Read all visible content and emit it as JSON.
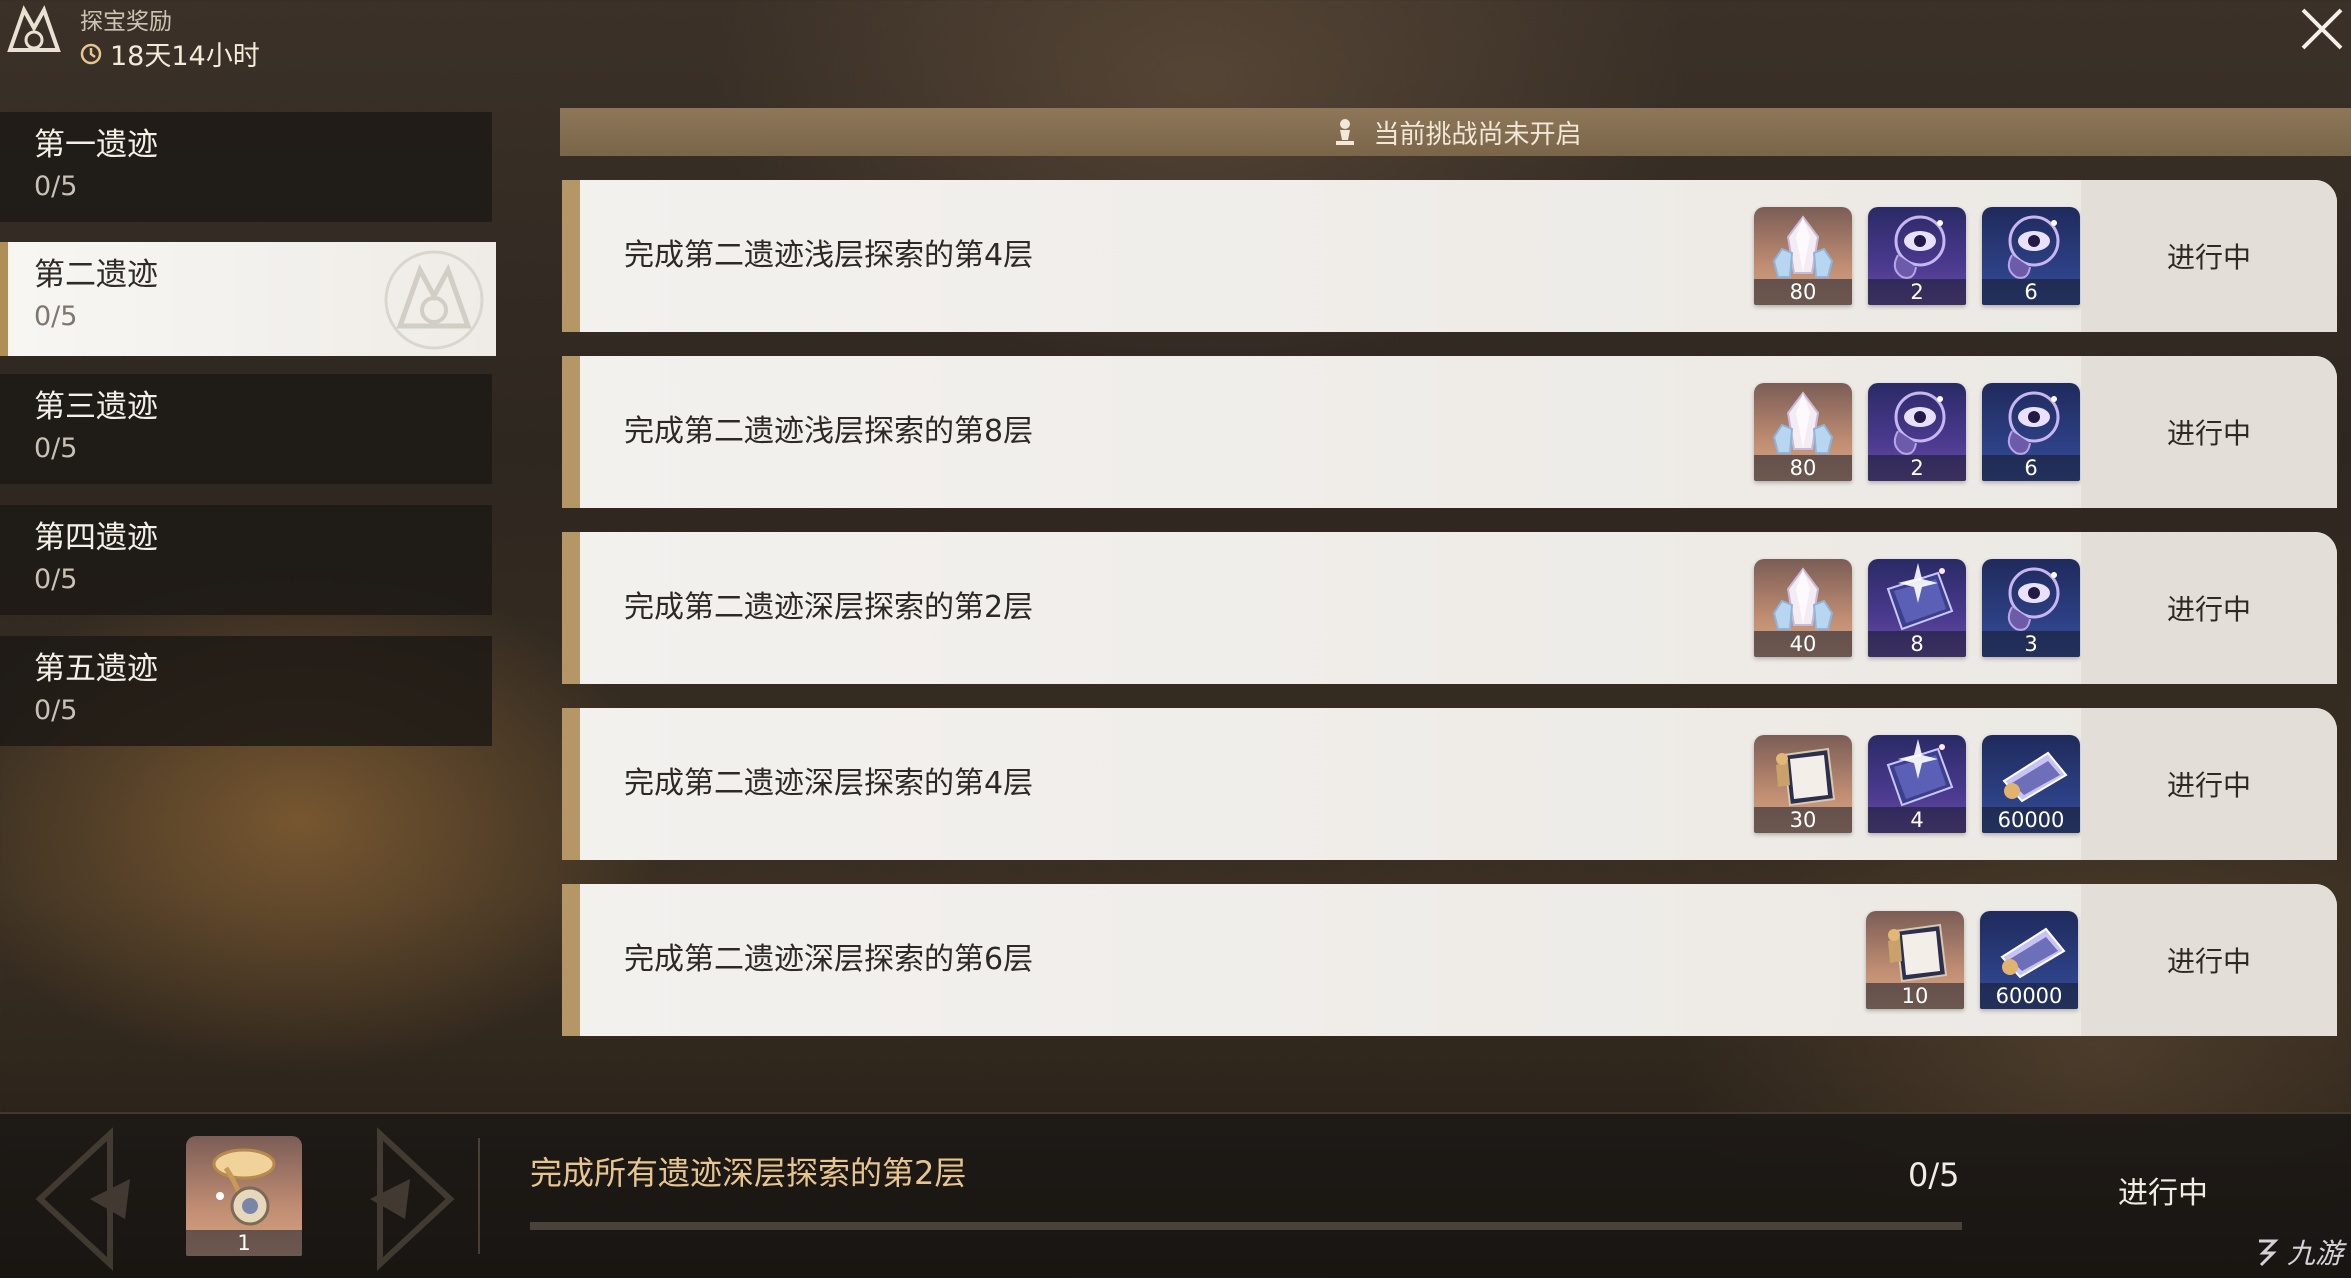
{
  "header": {
    "title": "探宝奖励",
    "timer": "18天14小时"
  },
  "sidebar": {
    "items": [
      {
        "name": "第一遗迹",
        "progress": "0/5",
        "active": false
      },
      {
        "name": "第二遗迹",
        "progress": "0/5",
        "active": true
      },
      {
        "name": "第三遗迹",
        "progress": "0/5",
        "active": false
      },
      {
        "name": "第四遗迹",
        "progress": "0/5",
        "active": false
      },
      {
        "name": "第五遗迹",
        "progress": "0/5",
        "active": false
      }
    ]
  },
  "banner": {
    "text": "当前挑战尚未开启"
  },
  "tasks": [
    {
      "label": "完成第二遗迹浅层探索的第4层",
      "status": "进行中",
      "rewards": [
        {
          "icon": "crystal-icon",
          "qty": "80"
        },
        {
          "icon": "eye-orb-icon",
          "qty": "2"
        },
        {
          "icon": "eye-orb-icon",
          "qty": "6"
        }
      ]
    },
    {
      "label": "完成第二遗迹浅层探索的第8层",
      "status": "进行中",
      "rewards": [
        {
          "icon": "crystal-icon",
          "qty": "80"
        },
        {
          "icon": "eye-orb-icon",
          "qty": "2"
        },
        {
          "icon": "eye-orb-icon",
          "qty": "6"
        }
      ]
    },
    {
      "label": "完成第二遗迹深层探索的第2层",
      "status": "进行中",
      "rewards": [
        {
          "icon": "crystal-icon",
          "qty": "40"
        },
        {
          "icon": "sparkle-book-icon",
          "qty": "8"
        },
        {
          "icon": "eye-orb-icon",
          "qty": "3"
        }
      ]
    },
    {
      "label": "完成第二遗迹深层探索的第4层",
      "status": "进行中",
      "rewards": [
        {
          "icon": "exp-book-icon",
          "qty": "30"
        },
        {
          "icon": "sparkle-book-icon",
          "qty": "4"
        },
        {
          "icon": "credit-card-icon",
          "qty": "60000"
        }
      ]
    },
    {
      "label": "完成第二遗迹深层探索的第6层",
      "status": "进行中",
      "rewards": [
        {
          "icon": "exp-book-icon",
          "qty": "10"
        },
        {
          "icon": "credit-card-icon",
          "qty": "60000"
        }
      ]
    }
  ],
  "bottom": {
    "label": "完成所有遗迹深层探索的第2层",
    "progress": "0/5",
    "progress_fraction": 0,
    "status": "进行中",
    "reward": {
      "icon": "compass-trophy-icon",
      "qty": "1"
    }
  },
  "watermark": {
    "text": "九游"
  },
  "colors": {
    "accent_gold": "#b59666",
    "banner_bg": "#8e7759",
    "row_bg": "#f3f1ee",
    "highlight_text": "#e8c58e"
  }
}
